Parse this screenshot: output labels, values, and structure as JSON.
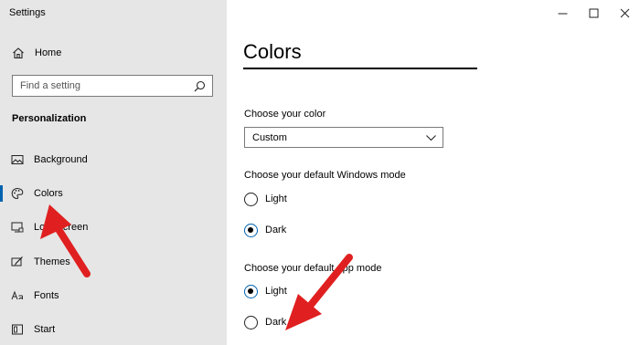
{
  "window": {
    "title": "Settings"
  },
  "sidebar": {
    "home_label": "Home",
    "search_placeholder": "Find a setting",
    "section_label": "Personalization",
    "items": [
      {
        "label": "Background",
        "icon": "image-icon"
      },
      {
        "label": "Colors",
        "icon": "palette-icon",
        "selected": true
      },
      {
        "label": "Lock screen",
        "icon": "lock-screen-icon"
      },
      {
        "label": "Themes",
        "icon": "themes-icon"
      },
      {
        "label": "Fonts",
        "icon": "fonts-icon"
      },
      {
        "label": "Start",
        "icon": "start-icon"
      }
    ]
  },
  "main": {
    "title": "Colors",
    "choose_color_label": "Choose your color",
    "choose_color_value": "Custom",
    "windows_mode_label": "Choose your default Windows mode",
    "windows_mode_options": [
      {
        "label": "Light",
        "checked": false
      },
      {
        "label": "Dark",
        "checked": true
      }
    ],
    "app_mode_label": "Choose your default app mode",
    "app_mode_options": [
      {
        "label": "Light",
        "checked": true
      },
      {
        "label": "Dark",
        "checked": false
      }
    ]
  },
  "colors": {
    "sidebar_bg": "#e6e6e6",
    "accent": "#0063b1",
    "annotation_arrow": "#e02020"
  }
}
